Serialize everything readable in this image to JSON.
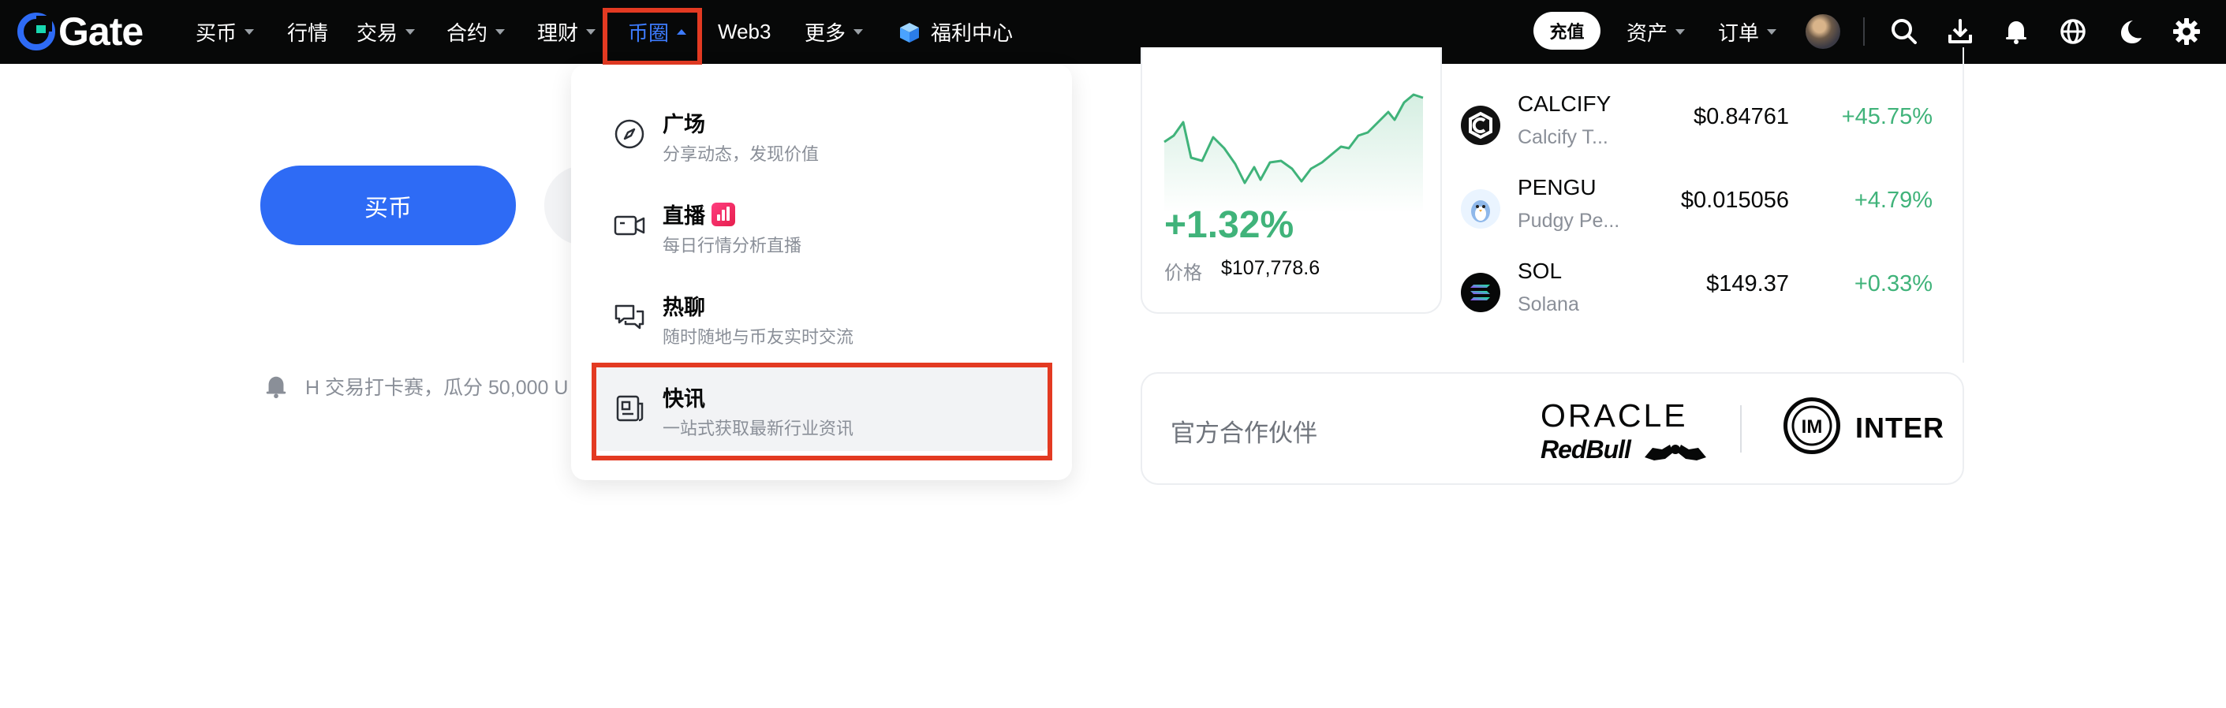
{
  "brand": {
    "name": "Gate",
    "accent": "#2e6bf5",
    "active_nav_color": "#3d7bff",
    "highlight_color": "#e33a22",
    "up_color": "#40b37a"
  },
  "nav": {
    "items": [
      {
        "label": "买币",
        "caret": true
      },
      {
        "label": "行情",
        "caret": false
      },
      {
        "label": "交易",
        "caret": true
      },
      {
        "label": "合约",
        "caret": true
      },
      {
        "label": "理财",
        "caret": true
      },
      {
        "label": "币圈",
        "caret": true,
        "active": true
      },
      {
        "label": "Web3",
        "caret": false
      },
      {
        "label": "更多",
        "caret": true
      },
      {
        "label": "福利中心",
        "caret": false
      }
    ],
    "deposit_label": "充值",
    "assets_label": "资产",
    "orders_label": "订单",
    "icons": [
      "search-icon",
      "download-icon",
      "bell-icon",
      "globe-icon",
      "moon-icon",
      "gear-icon"
    ]
  },
  "hero": {
    "buy_label": "买币",
    "notice_text": "H 交易打卡赛，瓜分 50,000 U"
  },
  "dropdown": {
    "items": [
      {
        "title": "广场",
        "subtitle": "分享动态，发现价值",
        "icon": "compass-icon"
      },
      {
        "title": "直播",
        "subtitle": "每日行情分析直播",
        "icon": "video-icon",
        "badge": "live-chart-badge"
      },
      {
        "title": "热聊",
        "subtitle": "随时随地与币友实时交流",
        "icon": "chat-icon"
      },
      {
        "title": "快讯",
        "subtitle": "一站式获取最新行业资讯",
        "icon": "news-icon",
        "hovered": true
      }
    ]
  },
  "market": {
    "change": "+1.32%",
    "price_label": "价格",
    "price_value": "$107,778.6",
    "coins": [
      {
        "symbol": "CALCIFY",
        "name": "Calcify T...",
        "price": "$0.84761",
        "change": "+45.75%"
      },
      {
        "symbol": "PENGU",
        "name": "Pudgy Pe...",
        "price": "$0.015056",
        "change": "+4.79%"
      },
      {
        "symbol": "SOL",
        "name": "Solana",
        "price": "$149.37",
        "change": "+0.33%"
      }
    ]
  },
  "partners": {
    "label": "官方合作伙伴",
    "oracle": "ORACLE",
    "redbull": "RedBull",
    "inter": "INTER"
  }
}
